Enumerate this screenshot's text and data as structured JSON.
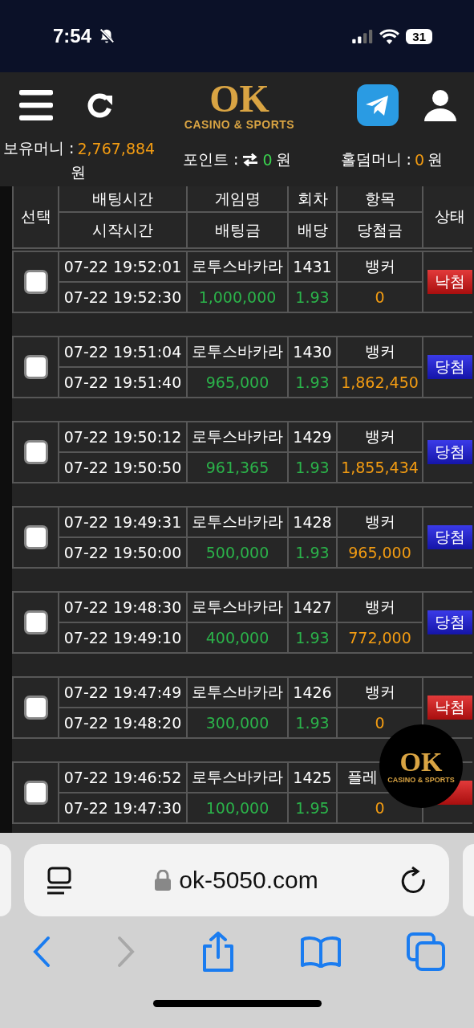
{
  "status_bar": {
    "time": "7:54",
    "battery": "31"
  },
  "header": {
    "logo": {
      "title": "OK",
      "subtitle": "CASINO & SPORTS"
    }
  },
  "balances": [
    {
      "label": "보유머니 :",
      "value": "2,767,884",
      "unit": "원",
      "kind": "money"
    },
    {
      "label": "포인트 :",
      "value": "0",
      "unit": "원",
      "kind": "point"
    },
    {
      "label": "홀덤머니 :",
      "value": "0",
      "unit": "원",
      "kind": "money"
    }
  ],
  "table": {
    "columns": {
      "select": "선택",
      "top": [
        "배팅시간",
        "게임명",
        "회차",
        "항목"
      ],
      "bottom": [
        "시작시간",
        "배팅금",
        "배당",
        "당첨금"
      ],
      "status": "상태"
    },
    "rows": [
      {
        "checked": false,
        "bet_time": "07-22 19:52:01",
        "game": "로투스바카라",
        "round": "1431",
        "item": "뱅커",
        "start_time": "07-22 19:52:30",
        "amount": "1,000,000",
        "odds": "1.93",
        "payout": "0",
        "status": {
          "kind": "lose",
          "label": "낙첨"
        }
      },
      {
        "checked": false,
        "bet_time": "07-22 19:51:04",
        "game": "로투스바카라",
        "round": "1430",
        "item": "뱅커",
        "start_time": "07-22 19:51:40",
        "amount": "965,000",
        "odds": "1.93",
        "payout": "1,862,450",
        "status": {
          "kind": "win",
          "label": "당첨"
        }
      },
      {
        "checked": false,
        "bet_time": "07-22 19:50:12",
        "game": "로투스바카라",
        "round": "1429",
        "item": "뱅커",
        "start_time": "07-22 19:50:50",
        "amount": "961,365",
        "odds": "1.93",
        "payout": "1,855,434",
        "status": {
          "kind": "win",
          "label": "당첨"
        }
      },
      {
        "checked": false,
        "bet_time": "07-22 19:49:31",
        "game": "로투스바카라",
        "round": "1428",
        "item": "뱅커",
        "start_time": "07-22 19:50:00",
        "amount": "500,000",
        "odds": "1.93",
        "payout": "965,000",
        "status": {
          "kind": "win",
          "label": "당첨"
        }
      },
      {
        "checked": false,
        "bet_time": "07-22 19:48:30",
        "game": "로투스바카라",
        "round": "1427",
        "item": "뱅커",
        "start_time": "07-22 19:49:10",
        "amount": "400,000",
        "odds": "1.93",
        "payout": "772,000",
        "status": {
          "kind": "win",
          "label": "당첨"
        }
      },
      {
        "checked": false,
        "bet_time": "07-22 19:47:49",
        "game": "로투스바카라",
        "round": "1426",
        "item": "뱅커",
        "start_time": "07-22 19:48:20",
        "amount": "300,000",
        "odds": "1.93",
        "payout": "0",
        "status": {
          "kind": "lose",
          "label": "낙첨"
        }
      },
      {
        "checked": false,
        "bet_time": "07-22 19:46:52",
        "game": "로투스바카라",
        "round": "1425",
        "item": "플레",
        "start_time": "07-22 19:47:30",
        "amount": "100,000",
        "odds": "1.95",
        "payout": "0",
        "status": {
          "kind": "lose"
        }
      }
    ]
  },
  "floating_logo": {
    "title": "OK",
    "subtitle": "CASINO & SPORTS"
  },
  "browser": {
    "url": "ok-5050.com"
  }
}
